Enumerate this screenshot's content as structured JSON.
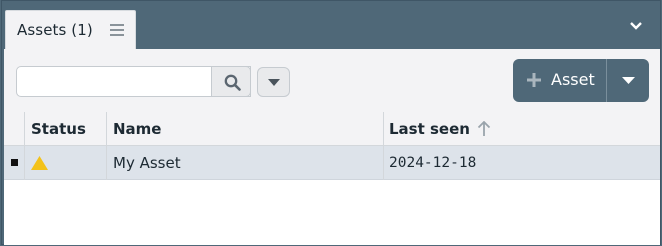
{
  "tab": {
    "label": "Assets (1)",
    "menu_icon": "hamburger-icon"
  },
  "panel": {
    "collapse_icon": "chevron-down-icon"
  },
  "toolbar": {
    "search": {
      "value": "",
      "placeholder": ""
    },
    "search_icon": "search-icon",
    "filter_icon": "caret-down-icon",
    "add_button": {
      "label": "Asset",
      "icon": "plus-icon",
      "dropdown_icon": "caret-down-icon"
    }
  },
  "table": {
    "columns": [
      {
        "label": "Status"
      },
      {
        "label": "Name"
      },
      {
        "label": "Last seen",
        "sort": "ascending",
        "sort_icon": "arrow-up-icon"
      }
    ],
    "rows": [
      {
        "status_icon": "warning-triangle-icon",
        "status_color": "#f3c21a",
        "name": "My Asset",
        "last_seen": "2024-12-18"
      }
    ]
  },
  "colors": {
    "panel_bg": "#4f6878",
    "content_bg": "#f3f3f5",
    "selected_row": "#dde3ea",
    "warning": "#f3c21a"
  }
}
